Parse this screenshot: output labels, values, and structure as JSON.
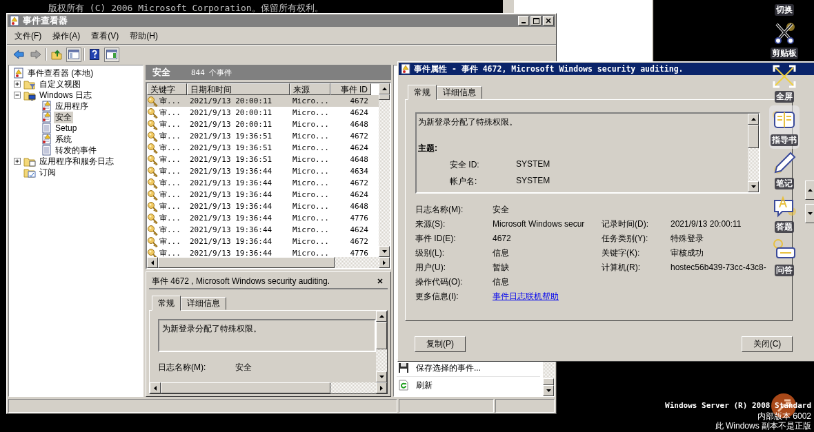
{
  "console": {
    "line": "版权所有 (C) 2006 Microsoft Corporation。保留所有权利。"
  },
  "event_viewer": {
    "title": "事件查看器",
    "menu": [
      "文件(F)",
      "操作(A)",
      "查看(V)",
      "帮助(H)"
    ],
    "tree": [
      {
        "label": "事件查看器 (本地)",
        "kind": "viewer",
        "selected": false,
        "children": [
          {
            "label": "自定义视图",
            "kind": "filter-folder",
            "expanded": false,
            "selected": false
          },
          {
            "label": "Windows 日志",
            "kind": "log-folder",
            "expanded": true,
            "selected": false,
            "children": [
              {
                "label": "应用程序",
                "kind": "log-warning",
                "selected": false
              },
              {
                "label": "安全",
                "kind": "log-warning",
                "selected": true
              },
              {
                "label": "Setup",
                "kind": "log",
                "selected": false
              },
              {
                "label": "系统",
                "kind": "log-warning",
                "selected": false
              },
              {
                "label": "转发的事件",
                "kind": "log",
                "selected": false
              }
            ]
          },
          {
            "label": "应用程序和服务日志",
            "kind": "folder",
            "expanded": false,
            "selected": false
          },
          {
            "label": "订阅",
            "kind": "subscription",
            "selected": false
          }
        ]
      }
    ],
    "list_title": "安全",
    "list_count": "844 个事件",
    "columns": [
      "关键字",
      "日期和时间",
      "来源",
      "事件 ID"
    ],
    "rows": [
      {
        "keyword": "审...",
        "datetime": "2021/9/13 20:00:11",
        "source": "Micro...",
        "id": "4672",
        "selected": true
      },
      {
        "keyword": "审...",
        "datetime": "2021/9/13 20:00:11",
        "source": "Micro...",
        "id": "4624",
        "selected": false
      },
      {
        "keyword": "审...",
        "datetime": "2021/9/13 20:00:11",
        "source": "Micro...",
        "id": "4648",
        "selected": false
      },
      {
        "keyword": "审...",
        "datetime": "2021/9/13 19:36:51",
        "source": "Micro...",
        "id": "4672",
        "selected": false
      },
      {
        "keyword": "审...",
        "datetime": "2021/9/13 19:36:51",
        "source": "Micro...",
        "id": "4624",
        "selected": false
      },
      {
        "keyword": "审...",
        "datetime": "2021/9/13 19:36:51",
        "source": "Micro...",
        "id": "4648",
        "selected": false
      },
      {
        "keyword": "审...",
        "datetime": "2021/9/13 19:36:44",
        "source": "Micro...",
        "id": "4634",
        "selected": false
      },
      {
        "keyword": "审...",
        "datetime": "2021/9/13 19:36:44",
        "source": "Micro...",
        "id": "4672",
        "selected": false
      },
      {
        "keyword": "审...",
        "datetime": "2021/9/13 19:36:44",
        "source": "Micro...",
        "id": "4624",
        "selected": false
      },
      {
        "keyword": "审...",
        "datetime": "2021/9/13 19:36:44",
        "source": "Micro...",
        "id": "4648",
        "selected": false
      },
      {
        "keyword": "审...",
        "datetime": "2021/9/13 19:36:44",
        "source": "Micro...",
        "id": "4776",
        "selected": false
      },
      {
        "keyword": "审...",
        "datetime": "2021/9/13 19:36:44",
        "source": "Micro...",
        "id": "4624",
        "selected": false
      },
      {
        "keyword": "审...",
        "datetime": "2021/9/13 19:36:44",
        "source": "Micro...",
        "id": "4672",
        "selected": false
      },
      {
        "keyword": "审...",
        "datetime": "2021/9/13 19:36:44",
        "source": "Micro...",
        "id": "4776",
        "selected": false
      }
    ],
    "preview": {
      "title": "事件 4672 , Microsoft Windows security auditing.",
      "tabs": [
        {
          "label": "常规",
          "selected": true
        },
        {
          "label": "详细信息",
          "selected": false
        }
      ],
      "description": "为新登录分配了特殊权限。",
      "field": {
        "label": "日志名称(M):",
        "value": "安全"
      }
    },
    "actions": [
      {
        "label": "保存选择的事件...",
        "kind": "save"
      },
      {
        "label": "刷新",
        "kind": "refresh"
      }
    ]
  },
  "dialog": {
    "title": "事件属性 - 事件 4672, Microsoft Windows security auditing.",
    "tabs": [
      {
        "label": "常规",
        "selected": true
      },
      {
        "label": "详细信息",
        "selected": false
      }
    ],
    "description": "为新登录分配了特殊权限。",
    "subject_heading": "主题:",
    "subject_rows": [
      {
        "label": "安全 ID:",
        "value": "SYSTEM"
      },
      {
        "label": "帐户名:",
        "value": "SYSTEM"
      }
    ],
    "fields": [
      {
        "label": "日志名称(M):",
        "value": "安全",
        "kind": "text"
      },
      {
        "label": "来源(S):",
        "value": "Microsoft Windows secur",
        "kind": "text",
        "right": {
          "label": "记录时间(D):",
          "value": "2021/9/13 20:00:11"
        }
      },
      {
        "label": "事件 ID(E):",
        "value": "4672",
        "kind": "text",
        "right": {
          "label": "任务类别(Y):",
          "value": "特殊登录"
        }
      },
      {
        "label": "级别(L):",
        "value": "信息",
        "kind": "text",
        "right": {
          "label": "关键字(K):",
          "value": "审核成功"
        }
      },
      {
        "label": "用户(U):",
        "value": "暂缺",
        "kind": "text",
        "right": {
          "label": "计算机(R):",
          "value": "hostec56b439-73cc-43c8-"
        }
      },
      {
        "label": "操作代码(O):",
        "value": "信息",
        "kind": "text"
      },
      {
        "label": "更多信息(I):",
        "value": "事件日志联机帮助",
        "kind": "link"
      }
    ],
    "buttons": [
      "复制(P)",
      "关闭(C)"
    ]
  },
  "overlay_toolbar": [
    {
      "label": "切换",
      "kind": "switch",
      "selected": false
    },
    {
      "label": "剪贴板",
      "kind": "clipboard",
      "selected": false
    },
    {
      "label": "全屏",
      "kind": "fullscreen",
      "selected": false
    },
    {
      "label": "指导书",
      "kind": "guide",
      "selected": true
    },
    {
      "label": "笔记",
      "kind": "notes",
      "selected": false
    },
    {
      "label": "答题",
      "kind": "answer",
      "selected": false
    },
    {
      "label": "问答",
      "kind": "qa",
      "selected": false
    }
  ],
  "desktop_text": [
    "Windows Server (R) 2008 Standard",
    "内部版本 6002",
    "此 Windows 副本不是正版"
  ]
}
